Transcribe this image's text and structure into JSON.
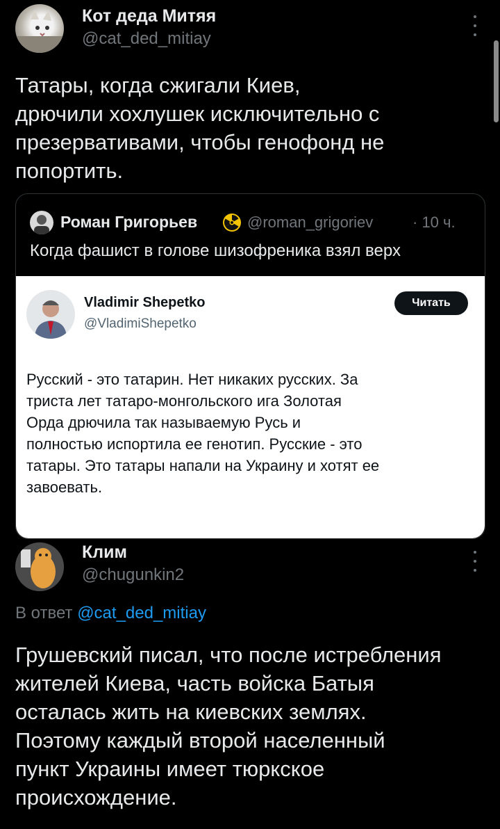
{
  "tweet1": {
    "author_name": "Кот деда Митяя",
    "handle": "@cat_ded_mitiay",
    "text_lines": [
      "Татары, когда сжигали Киев,",
      "дрючили хохлушек исключительно с",
      "презервативами, чтобы генофонд не",
      "попортить."
    ]
  },
  "quote": {
    "author_name": "Роман Григорьев",
    "badge_icon": "radioactive-icon",
    "handle": "@roman_grigoriev",
    "time": "· 10 ч.",
    "text": "Когда фашист в голове шизофреника взял верх",
    "card": {
      "author_name": "Vladimir Shepetko",
      "handle": "@VladimiShepetko",
      "read_button": "Читать",
      "text_lines": [
        "Русский - это татарин. Нет никаких русских. За",
        "триста лет татаро-монгольского ига Золотая",
        "Орда дрючила так называемую Русь и",
        "полностью испортила ее генотип. Русские - это",
        "татары. Это татары напали на Украину и хотят ее",
        "завоевать."
      ]
    }
  },
  "tweet2": {
    "author_name": "Клим",
    "handle": "@chugunkin2",
    "reply_prefix": "В ответ",
    "reply_handle": "@cat_ded_mitiay",
    "text_lines": [
      "Грушевский писал, что после истребления",
      "жителей Киева, часть войска Батыя",
      "осталась жить на киевских землях.",
      "Поэтому каждый второй населенный",
      "пункт Украины имеет тюркское",
      "происхождение."
    ]
  },
  "colors": {
    "background": "#000000",
    "text": "#e7e9ea",
    "muted": "#71767b",
    "link": "#1d9bf0",
    "card_bg": "#ffffff"
  }
}
